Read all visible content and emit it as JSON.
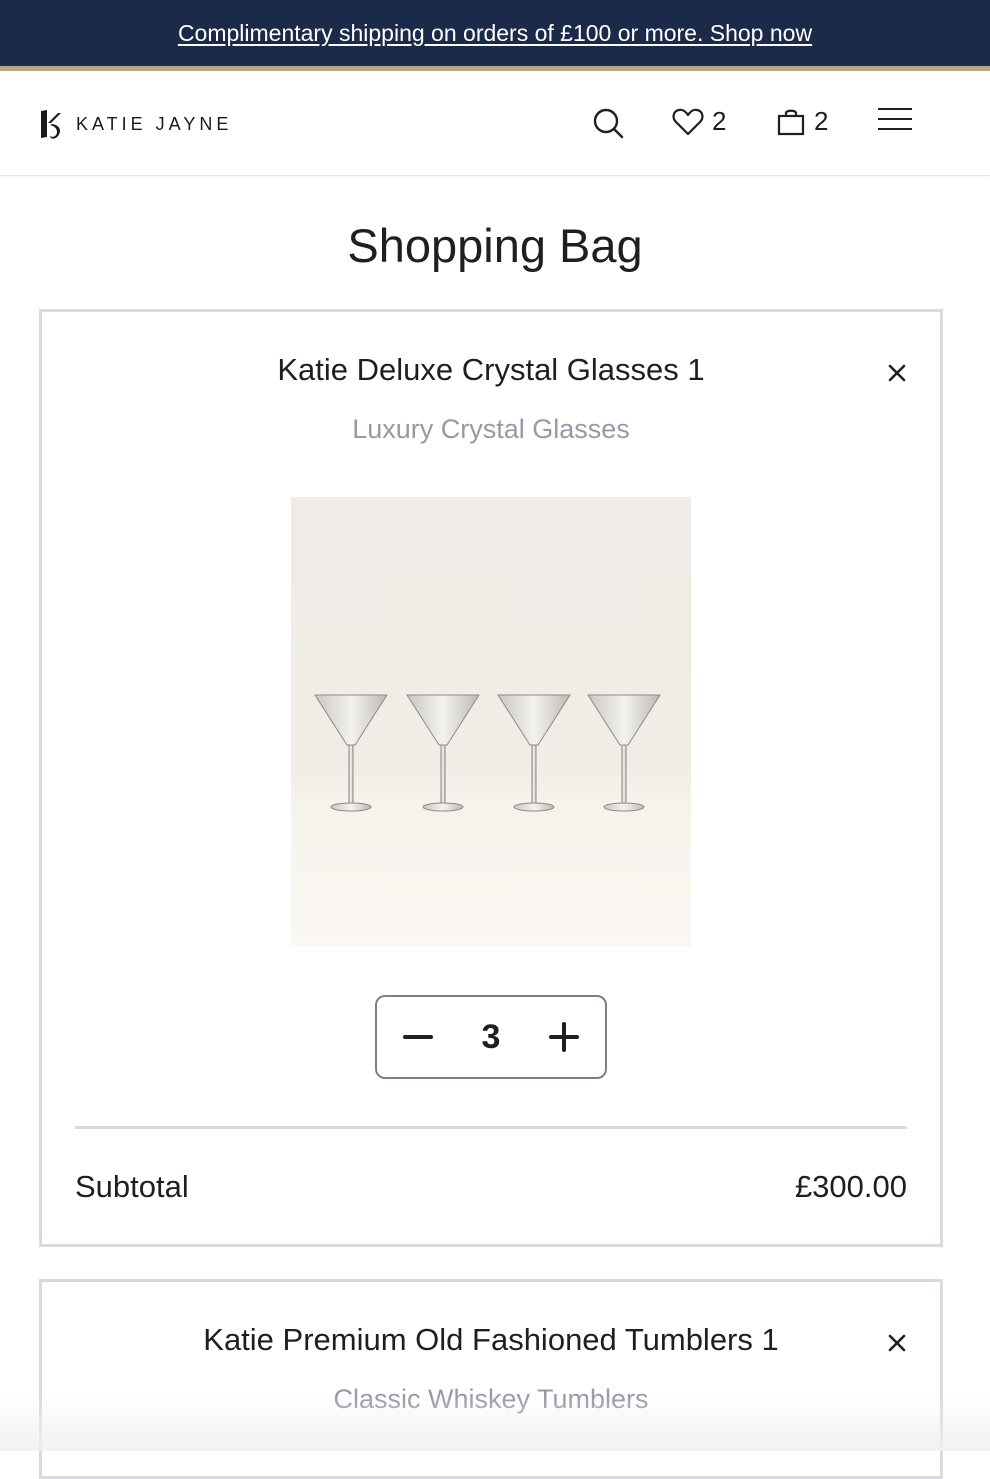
{
  "promo": {
    "text": "Complimentary shipping on orders of £100 or more. Shop now"
  },
  "header": {
    "brand": "KATIE JAYNE",
    "icons": {
      "search": "search-icon",
      "wishlist": "heart-icon",
      "bag": "shopping-bag-icon",
      "menu": "hamburger-menu-icon"
    },
    "wishlist_count": "2",
    "bag_count": "2"
  },
  "page": {
    "title": "Shopping Bag"
  },
  "items": [
    {
      "name": "Katie Deluxe Crystal Glasses 1",
      "subtitle": "Luxury Crystal Glasses",
      "quantity": "3",
      "subtotal_label": "Subtotal",
      "subtotal_value": "£300.00"
    },
    {
      "name": "Katie Premium Old Fashioned Tumblers 1",
      "subtitle": "Classic Whiskey Tumblers"
    }
  ],
  "colors": {
    "promo_bg": "#1c2a4a",
    "accent_gold": "#b8a584",
    "card_border": "#d9dae0",
    "muted_text": "#959aa6"
  }
}
